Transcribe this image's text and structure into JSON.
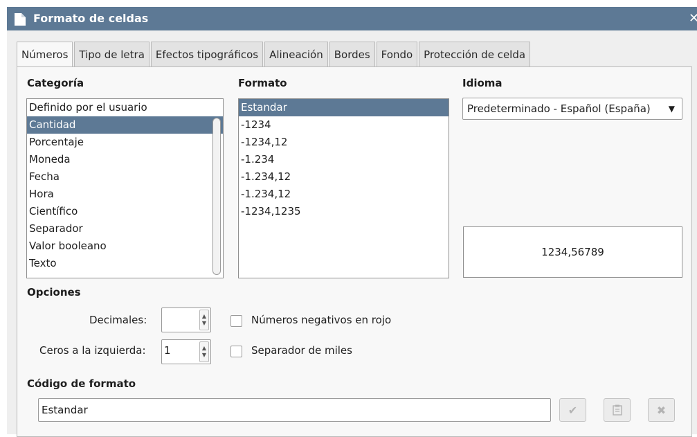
{
  "window": {
    "title": "Formato de celdas"
  },
  "tabs": [
    {
      "label": "Números",
      "active": true
    },
    {
      "label": "Tipo de letra"
    },
    {
      "label": "Efectos tipográficos"
    },
    {
      "label": "Alineación"
    },
    {
      "label": "Bordes"
    },
    {
      "label": "Fondo"
    },
    {
      "label": "Protección de celda"
    }
  ],
  "category": {
    "heading": "Categoría",
    "items": [
      "Definido por el usuario",
      "Cantidad",
      "Porcentaje",
      "Moneda",
      "Fecha",
      "Hora",
      "Científico",
      "Separador",
      "Valor booleano",
      "Texto"
    ],
    "selected": "Cantidad"
  },
  "format": {
    "heading": "Formato",
    "items": [
      "Estandar",
      "-1234",
      "-1234,12",
      "-1.234",
      "-1.234,12",
      "-1.234,12",
      "-1234,1235"
    ],
    "selected": "Estandar"
  },
  "language": {
    "heading": "Idioma",
    "selected": "Predeterminado - Español (España)"
  },
  "preview": {
    "value": "1234,56789"
  },
  "options": {
    "heading": "Opciones",
    "decimals_label": "Decimales:",
    "decimals_value": "",
    "leading_zeros_label": "Ceros a la izquierda:",
    "leading_zeros_value": "1",
    "negative_red_label": "Números negativos en rojo",
    "negative_red_checked": false,
    "thousands_sep_label": "Separador de miles",
    "thousands_sep_checked": false
  },
  "format_code": {
    "heading": "Código de formato",
    "value": "Estandar"
  },
  "colors": {
    "accent": "#5d7995",
    "panel": "#f8f8f8",
    "dialog": "#efefef"
  }
}
